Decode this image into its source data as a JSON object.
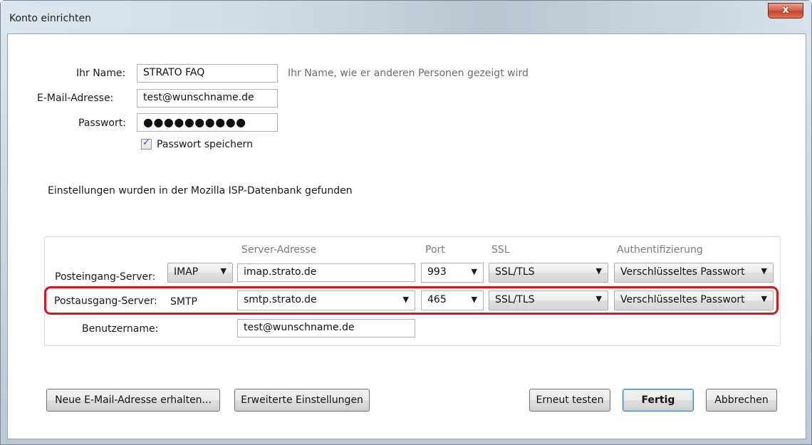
{
  "window": {
    "title": "Konto einrichten",
    "close_glyph": "x"
  },
  "account": {
    "name_label": "Ihr Name:",
    "name_value": "STRATO FAQ",
    "name_hint": "Ihr Name, wie er anderen Personen gezeigt wird",
    "email_label": "E-Mail-Adresse:",
    "email_value": "test@wunschname.de",
    "password_label": "Passwort:",
    "password_value": "●●●●●●●●●●",
    "save_password_label": "Passwort speichern",
    "save_password_checked": true
  },
  "status_message": "Einstellungen wurden in der Mozilla ISP-Datenbank gefunden",
  "server_table": {
    "headers": {
      "server_address": "Server-Adresse",
      "port": "Port",
      "ssl": "SSL",
      "authentication": "Authentifizierung"
    },
    "incoming": {
      "label": "Posteingang-Server:",
      "protocol": "IMAP",
      "server": "imap.strato.de",
      "port": "993",
      "ssl": "SSL/TLS",
      "auth": "Verschlüsseltes Passwort"
    },
    "outgoing": {
      "label": "Postausgang-Server:",
      "protocol": "SMTP",
      "server": "smtp.strato.de",
      "port": "465",
      "ssl": "SSL/TLS",
      "auth": "Verschlüsseltes Passwort"
    },
    "username_label": "Benutzername:",
    "username_value": "test@wunschname.de"
  },
  "buttons": {
    "new_email": "Neue E-Mail-Adresse erhalten...",
    "advanced": "Erweiterte Einstellungen",
    "retest": "Erneut testen",
    "done": "Fertig",
    "cancel": "Abbrechen"
  },
  "colors": {
    "highlight": "#e0111a",
    "close_button": "#c3442b",
    "default_button_border": "#3c7fb1"
  },
  "icons": {
    "dropdown": "chevron-down-icon",
    "close": "close-icon",
    "checkbox": "checkmark-icon"
  }
}
